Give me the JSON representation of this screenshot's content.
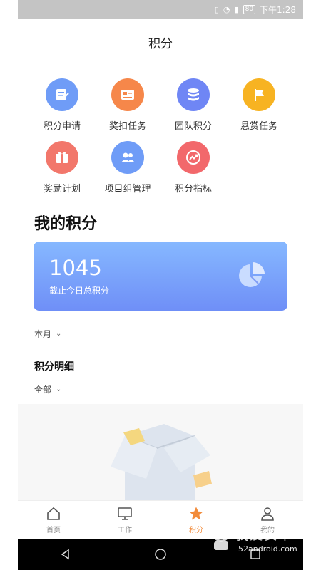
{
  "status_bar": {
    "time": "下午1:28",
    "battery": "80"
  },
  "header": {
    "title": "积分"
  },
  "grid": [
    {
      "label": "积分申请",
      "icon": "document-icon",
      "color": "#6f9cf7"
    },
    {
      "label": "奖扣任务",
      "icon": "task-card-icon",
      "color": "#f6874a"
    },
    {
      "label": "团队积分",
      "icon": "stack-icon",
      "color": "#6f86f5"
    },
    {
      "label": "悬赏任务",
      "icon": "flag-icon",
      "color": "#f7b322"
    },
    {
      "label": "奖励计划",
      "icon": "gift-icon",
      "color": "#f2776b"
    },
    {
      "label": "项目组管理",
      "icon": "group-icon",
      "color": "#6f9cf7"
    },
    {
      "label": "积分指标",
      "icon": "trend-icon",
      "color": "#f2686b"
    }
  ],
  "my_points": {
    "title": "我的积分",
    "total": "1045",
    "caption": "截止今日总积分"
  },
  "month_filter": {
    "label": "本月"
  },
  "detail": {
    "title": "积分明细",
    "filter_label": "全部"
  },
  "tabs": [
    {
      "label": "首页",
      "icon": "home-icon",
      "active": false
    },
    {
      "label": "工作",
      "icon": "monitor-icon",
      "active": false
    },
    {
      "label": "积分",
      "icon": "star-icon",
      "active": true
    },
    {
      "label": "我的",
      "icon": "person-icon",
      "active": false
    }
  ],
  "watermark": {
    "text": "我爱安卓",
    "site": "52android.com"
  }
}
